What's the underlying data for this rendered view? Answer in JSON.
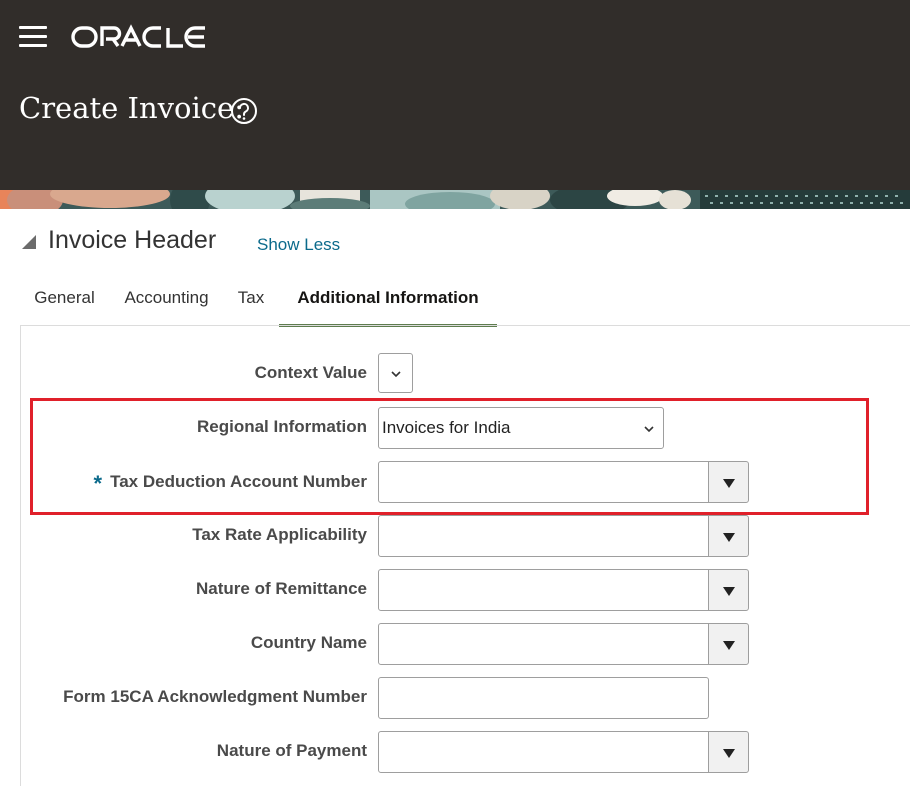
{
  "app": {
    "brand": "ORACLE",
    "page_title": "Create Invoice:"
  },
  "icons": {
    "menu": "hamburger-menu-icon",
    "help": "help-icon",
    "collapse": "collapse-triangle-icon",
    "dropdown": "chevron-down-icon",
    "lov": "triangle-down-icon"
  },
  "colors": {
    "header_bg": "#312d2a",
    "link": "#0b6a8b",
    "active_tab_underline": "#5f7d4f",
    "required_marker": "#0b6a8b",
    "highlight_border": "#e0202a"
  },
  "section": {
    "title": "Invoice Header",
    "toggle_label": "Show Less"
  },
  "tabs": [
    {
      "label": "General",
      "active": false
    },
    {
      "label": "Accounting",
      "active": false
    },
    {
      "label": "Tax",
      "active": false
    },
    {
      "label": "Additional Information",
      "active": true
    }
  ],
  "fields": {
    "context_value": {
      "label": "Context Value",
      "value": ""
    },
    "regional_information": {
      "label": "Regional Information",
      "value": "Invoices for India"
    },
    "tax_deduction_account_number": {
      "label": "Tax Deduction Account Number",
      "value": "",
      "required_marker": "*"
    },
    "tax_rate_applicability": {
      "label": "Tax Rate Applicability",
      "value": ""
    },
    "nature_of_remittance": {
      "label": "Nature of Remittance",
      "value": ""
    },
    "country_name": {
      "label": "Country Name",
      "value": ""
    },
    "form_15ca_ack_number": {
      "label": "Form 15CA Acknowledgment Number",
      "value": ""
    },
    "nature_of_payment": {
      "label": "Nature of Payment",
      "value": ""
    }
  }
}
